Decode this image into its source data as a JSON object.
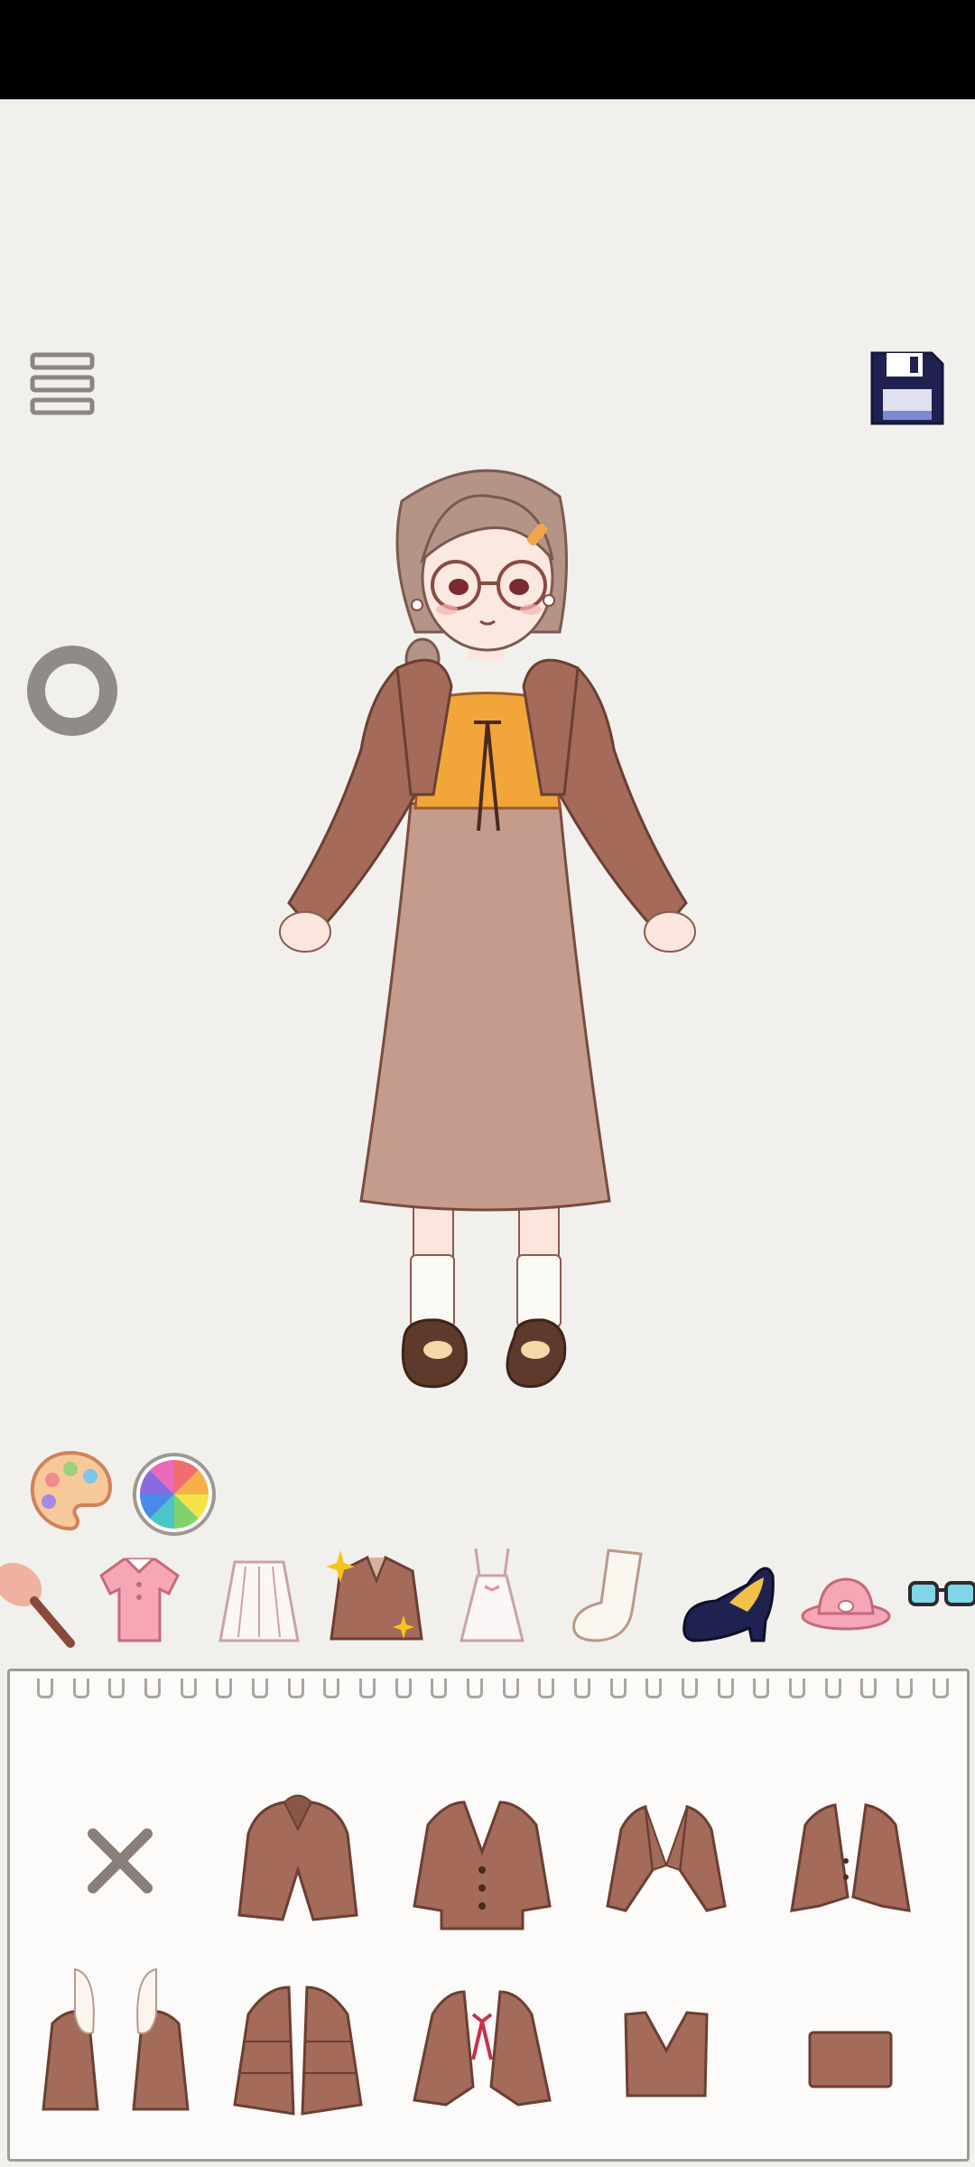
{
  "toolbar": {
    "menu_icon": "hamburger-menu-icon",
    "save_icon": "floppy-disk-icon",
    "rotate_icon": "ring-icon"
  },
  "color_tools": [
    "palette-icon",
    "color-wheel-icon"
  ],
  "categories": [
    {
      "name": "makeup-brush",
      "selected": false
    },
    {
      "name": "top",
      "selected": false
    },
    {
      "name": "skirt",
      "selected": false
    },
    {
      "name": "jacket",
      "selected": true
    },
    {
      "name": "dress",
      "selected": false
    },
    {
      "name": "socks",
      "selected": false
    },
    {
      "name": "shoes",
      "selected": false
    },
    {
      "name": "hat",
      "selected": false
    },
    {
      "name": "glasses",
      "selected": false
    }
  ],
  "items": [
    {
      "name": "none",
      "icon": "x-icon"
    },
    {
      "name": "hooded-jacket"
    },
    {
      "name": "cardigan"
    },
    {
      "name": "bolero"
    },
    {
      "name": "blazer"
    },
    {
      "name": "fur-jacket"
    },
    {
      "name": "puffer-jacket"
    },
    {
      "name": "bow-cardigan"
    },
    {
      "name": "vest"
    },
    {
      "name": "tube-top"
    }
  ],
  "colors": {
    "background": "#f2f0ed",
    "garment": "#a46a5a",
    "outline": "#6b3f33",
    "save_icon": "#1f2250"
  }
}
